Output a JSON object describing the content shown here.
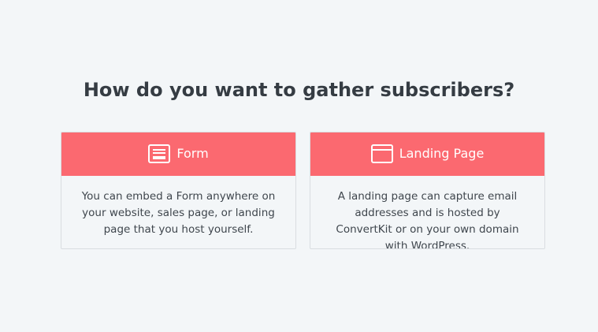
{
  "page": {
    "title": "How do you want to gather subscribers?"
  },
  "options": [
    {
      "label": "Form",
      "icon": "form-icon",
      "description": "You can embed a Form anywhere on your website, sales page, or landing page that you host yourself."
    },
    {
      "label": "Landing Page",
      "icon": "browser-window-icon",
      "description": "A landing page can capture email addresses and is hosted by ConvertKit or on your own domain with WordPress."
    }
  ],
  "colors": {
    "background": "#f3f6f8",
    "accent": "#fb6970",
    "heading": "#353c43",
    "body_text": "#3f464d",
    "card_border": "#d9dde1"
  }
}
